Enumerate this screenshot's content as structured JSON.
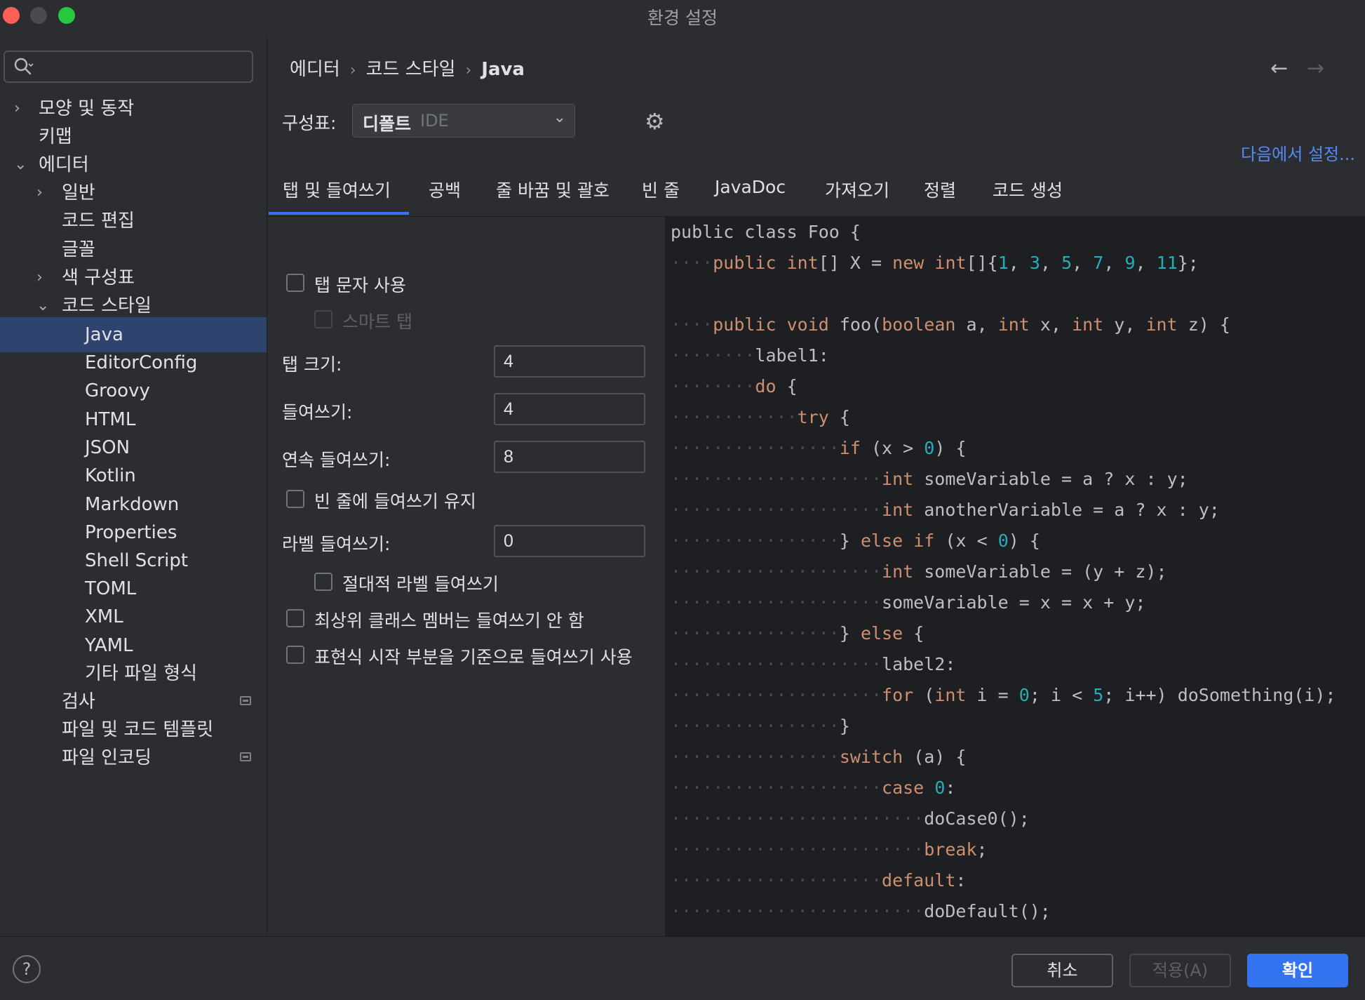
{
  "window": {
    "title": "환경 설정"
  },
  "sidebar": {
    "search_value": "",
    "items": [
      {
        "label": "모양 및 동작",
        "arrow": "›"
      },
      {
        "label": "키맵"
      },
      {
        "label": "에디터",
        "arrow": "⌄"
      },
      {
        "label": "일반",
        "arrow": "›"
      },
      {
        "label": "코드 편집"
      },
      {
        "label": "글꼴"
      },
      {
        "label": "색 구성표",
        "arrow": "›"
      },
      {
        "label": "코드 스타일",
        "arrow": "⌄"
      },
      {
        "label": "Java",
        "selected": true
      },
      {
        "label": "EditorConfig"
      },
      {
        "label": "Groovy"
      },
      {
        "label": "HTML"
      },
      {
        "label": "JSON"
      },
      {
        "label": "Kotlin"
      },
      {
        "label": "Markdown"
      },
      {
        "label": "Properties"
      },
      {
        "label": "Shell Script"
      },
      {
        "label": "TOML"
      },
      {
        "label": "XML"
      },
      {
        "label": "YAML"
      },
      {
        "label": "기타 파일 형식"
      },
      {
        "label": "검사",
        "badge": "settings-scope-icon"
      },
      {
        "label": "파일 및 코드 템플릿"
      },
      {
        "label": "파일 인코딩",
        "badge": "settings-scope-icon"
      }
    ]
  },
  "breadcrumb": [
    "에디터",
    "코드 스타일",
    "Java"
  ],
  "breadcrumb_separator": "›",
  "nav": {
    "back": "←",
    "forward": "→"
  },
  "scheme": {
    "label": "구성표:",
    "name": "디폴트",
    "sub": "IDE",
    "dropdown_icon": "⌄",
    "gear_icon": "⚙"
  },
  "set_from": "다음에서 설정...",
  "tabs": [
    "탭 및 들여쓰기",
    "공백",
    "줄 바꿈 및 괄호",
    "빈 줄",
    "JavaDoc",
    "가져오기",
    "정렬",
    "코드 생성"
  ],
  "options": {
    "use_tab": "탭 문자 사용",
    "smart_tab": "스마트 탭",
    "tab_size_label": "탭 크기:",
    "tab_size": "4",
    "indent_label": "들여쓰기:",
    "indent": "4",
    "cont_indent_label": "연속 들여쓰기:",
    "cont_indent": "8",
    "keep_indent_empty": "빈 줄에 들여쓰기 유지",
    "label_indent_label": "라벨 들여쓰기:",
    "label_indent": "0",
    "absolute_label_indent": "절대적 라벨 들여쓰기",
    "no_indent_top_level": "최상위 클래스 멤버는 들여쓰기 안 함",
    "indent_expr_start": "표현식 시작 부분을 기준으로 들여쓰기 사용"
  },
  "code_preview": [
    [
      [
        "t",
        "public"
      ],
      [
        "s",
        " "
      ],
      [
        "t",
        "class"
      ],
      [
        "s",
        " "
      ],
      [
        "t",
        "Foo"
      ],
      [
        "s",
        " "
      ],
      [
        "t",
        "{"
      ]
    ],
    [
      [
        "s",
        "····"
      ],
      [
        "k",
        "public"
      ],
      [
        "s",
        " "
      ],
      [
        "k",
        "int"
      ],
      [
        "t",
        "[]"
      ],
      [
        "s",
        " "
      ],
      [
        "t",
        "X"
      ],
      [
        "s",
        " "
      ],
      [
        "t",
        "="
      ],
      [
        "s",
        " "
      ],
      [
        "k",
        "new"
      ],
      [
        "s",
        " "
      ],
      [
        "k",
        "int"
      ],
      [
        "t",
        "[]{"
      ],
      [
        "n",
        "1"
      ],
      [
        "t",
        ","
      ],
      [
        "s",
        " "
      ],
      [
        "n",
        "3"
      ],
      [
        "t",
        ","
      ],
      [
        "s",
        " "
      ],
      [
        "n",
        "5"
      ],
      [
        "t",
        ","
      ],
      [
        "s",
        " "
      ],
      [
        "n",
        "7"
      ],
      [
        "t",
        ","
      ],
      [
        "s",
        " "
      ],
      [
        "n",
        "9"
      ],
      [
        "t",
        ","
      ],
      [
        "s",
        " "
      ],
      [
        "n",
        "11"
      ],
      [
        "t",
        "};"
      ]
    ],
    [],
    [
      [
        "s",
        "····"
      ],
      [
        "k",
        "public"
      ],
      [
        "s",
        " "
      ],
      [
        "k",
        "void"
      ],
      [
        "s",
        " "
      ],
      [
        "t",
        "foo("
      ],
      [
        "k",
        "boolean"
      ],
      [
        "s",
        " "
      ],
      [
        "t",
        "a,"
      ],
      [
        "s",
        " "
      ],
      [
        "k",
        "int"
      ],
      [
        "s",
        " "
      ],
      [
        "t",
        "x,"
      ],
      [
        "s",
        " "
      ],
      [
        "k",
        "int"
      ],
      [
        "s",
        " "
      ],
      [
        "t",
        "y,"
      ],
      [
        "s",
        " "
      ],
      [
        "k",
        "int"
      ],
      [
        "s",
        " "
      ],
      [
        "t",
        "z)"
      ],
      [
        "s",
        " "
      ],
      [
        "t",
        "{"
      ]
    ],
    [
      [
        "s",
        "········"
      ],
      [
        "t",
        "label1:"
      ]
    ],
    [
      [
        "s",
        "········"
      ],
      [
        "k",
        "do"
      ],
      [
        "s",
        " "
      ],
      [
        "t",
        "{"
      ]
    ],
    [
      [
        "s",
        "············"
      ],
      [
        "k",
        "try"
      ],
      [
        "s",
        " "
      ],
      [
        "t",
        "{"
      ]
    ],
    [
      [
        "s",
        "················"
      ],
      [
        "k",
        "if"
      ],
      [
        "s",
        " "
      ],
      [
        "t",
        "(x"
      ],
      [
        "s",
        " "
      ],
      [
        "t",
        ">"
      ],
      [
        "s",
        " "
      ],
      [
        "n",
        "0"
      ],
      [
        "t",
        ")"
      ],
      [
        "s",
        " "
      ],
      [
        "t",
        "{"
      ]
    ],
    [
      [
        "s",
        "····················"
      ],
      [
        "k",
        "int"
      ],
      [
        "s",
        " "
      ],
      [
        "t",
        "someVariable"
      ],
      [
        "s",
        " "
      ],
      [
        "t",
        "="
      ],
      [
        "s",
        " "
      ],
      [
        "t",
        "a"
      ],
      [
        "s",
        " "
      ],
      [
        "t",
        "?"
      ],
      [
        "s",
        " "
      ],
      [
        "t",
        "x"
      ],
      [
        "s",
        " "
      ],
      [
        "t",
        ":"
      ],
      [
        "s",
        " "
      ],
      [
        "t",
        "y;"
      ]
    ],
    [
      [
        "s",
        "····················"
      ],
      [
        "k",
        "int"
      ],
      [
        "s",
        " "
      ],
      [
        "t",
        "anotherVariable"
      ],
      [
        "s",
        " "
      ],
      [
        "t",
        "="
      ],
      [
        "s",
        " "
      ],
      [
        "t",
        "a"
      ],
      [
        "s",
        " "
      ],
      [
        "t",
        "?"
      ],
      [
        "s",
        " "
      ],
      [
        "t",
        "x"
      ],
      [
        "s",
        " "
      ],
      [
        "t",
        ":"
      ],
      [
        "s",
        " "
      ],
      [
        "t",
        "y;"
      ]
    ],
    [
      [
        "s",
        "················"
      ],
      [
        "t",
        "}"
      ],
      [
        "s",
        " "
      ],
      [
        "k",
        "else"
      ],
      [
        "s",
        " "
      ],
      [
        "k",
        "if"
      ],
      [
        "s",
        " "
      ],
      [
        "t",
        "(x"
      ],
      [
        "s",
        " "
      ],
      [
        "t",
        "<"
      ],
      [
        "s",
        " "
      ],
      [
        "n",
        "0"
      ],
      [
        "t",
        ")"
      ],
      [
        "s",
        " "
      ],
      [
        "t",
        "{"
      ]
    ],
    [
      [
        "s",
        "····················"
      ],
      [
        "k",
        "int"
      ],
      [
        "s",
        " "
      ],
      [
        "t",
        "someVariable"
      ],
      [
        "s",
        " "
      ],
      [
        "t",
        "="
      ],
      [
        "s",
        " "
      ],
      [
        "t",
        "(y"
      ],
      [
        "s",
        " "
      ],
      [
        "t",
        "+"
      ],
      [
        "s",
        " "
      ],
      [
        "t",
        "z);"
      ]
    ],
    [
      [
        "s",
        "····················"
      ],
      [
        "t",
        "someVariable"
      ],
      [
        "s",
        " "
      ],
      [
        "t",
        "="
      ],
      [
        "s",
        " "
      ],
      [
        "t",
        "x"
      ],
      [
        "s",
        " "
      ],
      [
        "t",
        "="
      ],
      [
        "s",
        " "
      ],
      [
        "t",
        "x"
      ],
      [
        "s",
        " "
      ],
      [
        "t",
        "+"
      ],
      [
        "s",
        " "
      ],
      [
        "t",
        "y;"
      ]
    ],
    [
      [
        "s",
        "················"
      ],
      [
        "t",
        "}"
      ],
      [
        "s",
        " "
      ],
      [
        "k",
        "else"
      ],
      [
        "s",
        " "
      ],
      [
        "t",
        "{"
      ]
    ],
    [
      [
        "s",
        "····················"
      ],
      [
        "t",
        "label2:"
      ]
    ],
    [
      [
        "s",
        "····················"
      ],
      [
        "k",
        "for"
      ],
      [
        "s",
        " "
      ],
      [
        "t",
        "("
      ],
      [
        "k",
        "int"
      ],
      [
        "s",
        " "
      ],
      [
        "t",
        "i"
      ],
      [
        "s",
        " "
      ],
      [
        "t",
        "="
      ],
      [
        "s",
        " "
      ],
      [
        "n",
        "0"
      ],
      [
        "t",
        ";"
      ],
      [
        "s",
        " "
      ],
      [
        "t",
        "i"
      ],
      [
        "s",
        " "
      ],
      [
        "t",
        "<"
      ],
      [
        "s",
        " "
      ],
      [
        "n",
        "5"
      ],
      [
        "t",
        ";"
      ],
      [
        "s",
        " "
      ],
      [
        "t",
        "i++)"
      ],
      [
        "s",
        " "
      ],
      [
        "t",
        "doSomething(i);"
      ]
    ],
    [
      [
        "s",
        "················"
      ],
      [
        "t",
        "}"
      ]
    ],
    [
      [
        "s",
        "················"
      ],
      [
        "k",
        "switch"
      ],
      [
        "s",
        " "
      ],
      [
        "t",
        "(a)"
      ],
      [
        "s",
        " "
      ],
      [
        "t",
        "{"
      ]
    ],
    [
      [
        "s",
        "····················"
      ],
      [
        "k",
        "case"
      ],
      [
        "s",
        " "
      ],
      [
        "n",
        "0"
      ],
      [
        "t",
        ":"
      ]
    ],
    [
      [
        "s",
        "························"
      ],
      [
        "t",
        "doCase0();"
      ]
    ],
    [
      [
        "s",
        "························"
      ],
      [
        "k",
        "break"
      ],
      [
        "t",
        ";"
      ]
    ],
    [
      [
        "s",
        "····················"
      ],
      [
        "k",
        "default"
      ],
      [
        "t",
        ":"
      ]
    ],
    [
      [
        "s",
        "························"
      ],
      [
        "t",
        "doDefault();"
      ]
    ]
  ],
  "footer": {
    "help": "?",
    "cancel": "취소",
    "apply": "적용(A)",
    "ok": "확인"
  },
  "colors": {
    "accent": "#3574f0",
    "link": "#548af7",
    "keyword": "#cf8e6d",
    "number": "#2aacb8",
    "selected_row": "#2e436e"
  }
}
